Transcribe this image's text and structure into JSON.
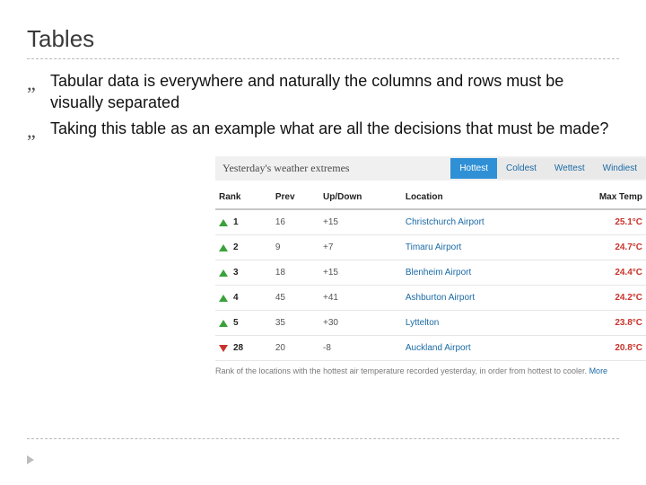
{
  "slide": {
    "title": "Tables",
    "bullets": [
      "Tabular data is everywhere and naturally the columns and rows must be visually separated",
      " Taking this table as an example what are all the decisions that must be made?"
    ],
    "bullet_glyph": "„"
  },
  "panel": {
    "title": "Yesterday's weather extremes",
    "tabs": [
      "Hottest",
      "Coldest",
      "Wettest",
      "Windiest"
    ],
    "active_tab_index": 0
  },
  "table": {
    "columns": [
      "Rank",
      "Prev",
      "Up/Down",
      "Location",
      "Max Temp"
    ],
    "rows": [
      {
        "dir": "up",
        "rank": "1",
        "prev": "16",
        "updown": "+15",
        "location": "Christchurch Airport",
        "temp": "25.1°C"
      },
      {
        "dir": "up",
        "rank": "2",
        "prev": "9",
        "updown": "+7",
        "location": "Timaru Airport",
        "temp": "24.7°C"
      },
      {
        "dir": "up",
        "rank": "3",
        "prev": "18",
        "updown": "+15",
        "location": "Blenheim Airport",
        "temp": "24.4°C"
      },
      {
        "dir": "up",
        "rank": "4",
        "prev": "45",
        "updown": "+41",
        "location": "Ashburton Airport",
        "temp": "24.2°C"
      },
      {
        "dir": "up",
        "rank": "5",
        "prev": "35",
        "updown": "+30",
        "location": "Lyttelton",
        "temp": "23.8°C"
      },
      {
        "dir": "down",
        "rank": "28",
        "prev": "20",
        "updown": "-8",
        "location": "Auckland Airport",
        "temp": "20.8°C"
      }
    ],
    "caption": "Rank of the locations with the hottest air temperature recorded yesterday, in order from hottest to cooler.",
    "more": "More"
  }
}
